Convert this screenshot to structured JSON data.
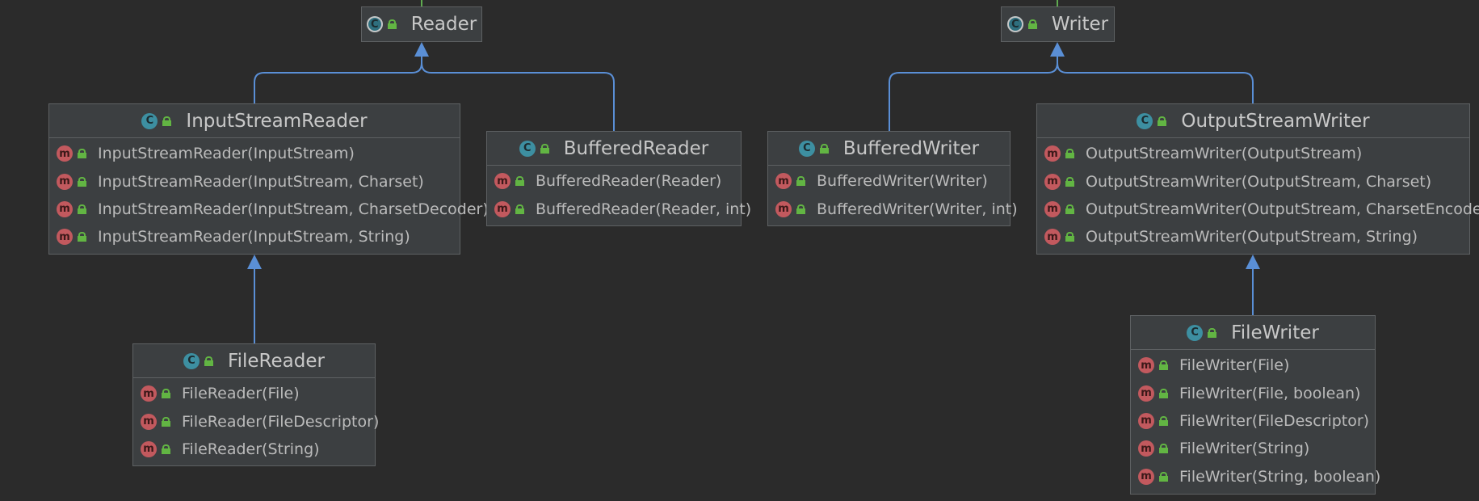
{
  "diagram": {
    "icons": {
      "class": "class-icon",
      "abstract_class": "abstract-class-icon",
      "method": "method-icon",
      "public": "lock-icon"
    },
    "colors": {
      "background": "#2b2b2b",
      "node_fill": "#3c3f41",
      "node_border": "#5e6163",
      "inheritance_edge": "#5a8fd6",
      "top_edge": "#5faa50"
    },
    "nodes": {
      "reader": {
        "name": "Reader",
        "members": []
      },
      "writer": {
        "name": "Writer",
        "members": []
      },
      "input_stream_reader": {
        "name": "InputStreamReader",
        "members": [
          "InputStreamReader(InputStream)",
          "InputStreamReader(InputStream, Charset)",
          "InputStreamReader(InputStream, CharsetDecoder)",
          "InputStreamReader(InputStream, String)"
        ]
      },
      "buffered_reader": {
        "name": "BufferedReader",
        "members": [
          "BufferedReader(Reader)",
          "BufferedReader(Reader, int)"
        ]
      },
      "buffered_writer": {
        "name": "BufferedWriter",
        "members": [
          "BufferedWriter(Writer)",
          "BufferedWriter(Writer, int)"
        ]
      },
      "output_stream_writer": {
        "name": "OutputStreamWriter",
        "members": [
          "OutputStreamWriter(OutputStream)",
          "OutputStreamWriter(OutputStream, Charset)",
          "OutputStreamWriter(OutputStream, CharsetEncoder)",
          "OutputStreamWriter(OutputStream, String)"
        ]
      },
      "file_reader": {
        "name": "FileReader",
        "members": [
          "FileReader(File)",
          "FileReader(FileDescriptor)",
          "FileReader(String)"
        ]
      },
      "file_writer": {
        "name": "FileWriter",
        "members": [
          "FileWriter(File)",
          "FileWriter(File, boolean)",
          "FileWriter(FileDescriptor)",
          "FileWriter(String)",
          "FileWriter(String, boolean)"
        ]
      }
    },
    "edges": [
      {
        "from": "input_stream_reader",
        "to": "reader",
        "type": "extends"
      },
      {
        "from": "buffered_reader",
        "to": "reader",
        "type": "extends"
      },
      {
        "from": "buffered_writer",
        "to": "writer",
        "type": "extends"
      },
      {
        "from": "output_stream_writer",
        "to": "writer",
        "type": "extends"
      },
      {
        "from": "file_reader",
        "to": "input_stream_reader",
        "type": "extends"
      },
      {
        "from": "file_writer",
        "to": "output_stream_writer",
        "type": "extends"
      }
    ]
  }
}
